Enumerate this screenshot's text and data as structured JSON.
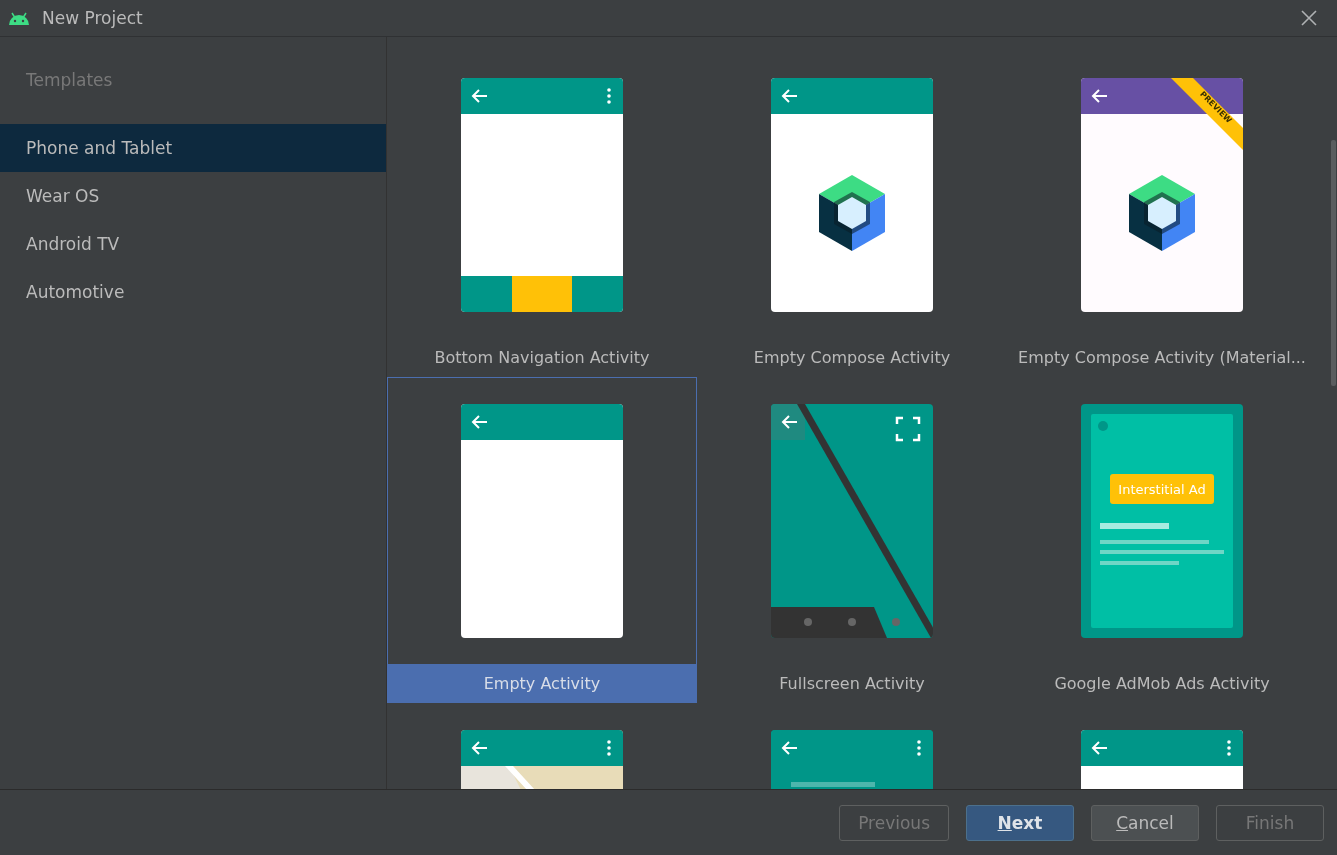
{
  "window": {
    "title": "New Project"
  },
  "sidebar": {
    "heading": "Templates",
    "items": [
      {
        "label": "Phone and Tablet",
        "selected": true
      },
      {
        "label": "Wear OS",
        "selected": false
      },
      {
        "label": "Android TV",
        "selected": false
      },
      {
        "label": "Automotive",
        "selected": false
      }
    ]
  },
  "templates": [
    {
      "kind": "bottom_nav",
      "label": "Bottom Navigation Activity",
      "selected": false,
      "menu": true
    },
    {
      "kind": "compose",
      "label": "Empty Compose Activity",
      "selected": false,
      "menu": false
    },
    {
      "kind": "compose_m3",
      "label": "Empty Compose Activity (Material...",
      "selected": false,
      "menu": false,
      "ribbon": "PREVIEW"
    },
    {
      "kind": "empty",
      "label": "Empty Activity",
      "selected": true,
      "menu": false
    },
    {
      "kind": "fullscreen",
      "label": "Fullscreen Activity",
      "selected": false
    },
    {
      "kind": "admob",
      "label": "Google AdMob Ads Activity",
      "selected": false,
      "badge": "Interstitial Ad"
    },
    {
      "kind": "maps",
      "selected": false,
      "menu": true
    },
    {
      "kind": "scrolling",
      "selected": false,
      "menu": true
    },
    {
      "kind": "list",
      "selected": false,
      "menu": true
    }
  ],
  "buttons": [
    {
      "label": "Previous",
      "kind": "default",
      "disabled": true,
      "mnemonic": false
    },
    {
      "label": "Next",
      "kind": "primary",
      "disabled": false,
      "mnemonic": true
    },
    {
      "label": "Cancel",
      "kind": "default",
      "disabled": false,
      "mnemonic": true
    },
    {
      "label": "Finish",
      "kind": "default",
      "disabled": true,
      "mnemonic": false
    }
  ]
}
